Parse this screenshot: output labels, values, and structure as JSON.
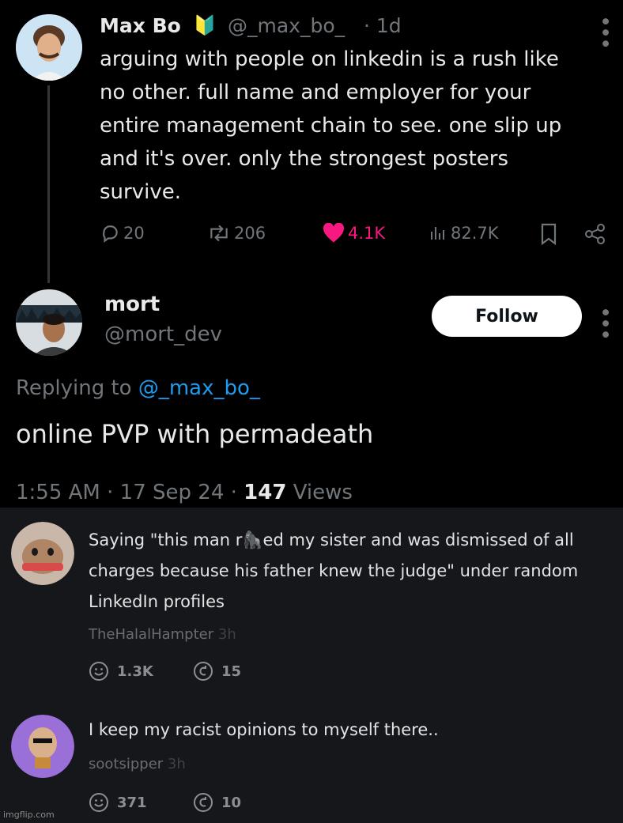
{
  "tweet": {
    "author_name": "Max Bo",
    "badge": "🔰",
    "handle": "@_max_bo_",
    "time": "· 1d",
    "lines": [
      "arguing with people on linkedin is a rush like",
      "no other. full name and employer for your",
      "entire management chain to see. one slip up",
      "and it's over. only the strongest posters",
      "survive."
    ],
    "replies": "20",
    "retweets": "206",
    "likes": "4.1K",
    "views": "82.7K",
    "like_color": "#f91880"
  },
  "reply": {
    "author_name": "mort",
    "handle": "@mort_dev",
    "follow_label": "Follow",
    "replying_prefix": "Replying to",
    "replying_handle": "@_max_bo_",
    "text": "online PVP with permadeath",
    "timestamp": "1:55 AM · 17 Sep 24 ·",
    "views_count": "147",
    "views_label": "Views",
    "link_color": "#1d9bf0"
  },
  "comments": [
    {
      "lines": [
        "Saying \"this man r🦍ed my sister and was dismissed of all",
        "charges because his father knew the judge\" under random",
        "LinkedIn profiles"
      ],
      "username": "TheHalalHampter",
      "age": "3h",
      "reactions": "1.3K",
      "shares": "15"
    },
    {
      "lines": [
        "I keep my racist opinions to myself there.."
      ],
      "username": "sootsipper",
      "age": "3h",
      "reactions": "371",
      "shares": "10"
    }
  ],
  "watermark": "imgflip.com"
}
